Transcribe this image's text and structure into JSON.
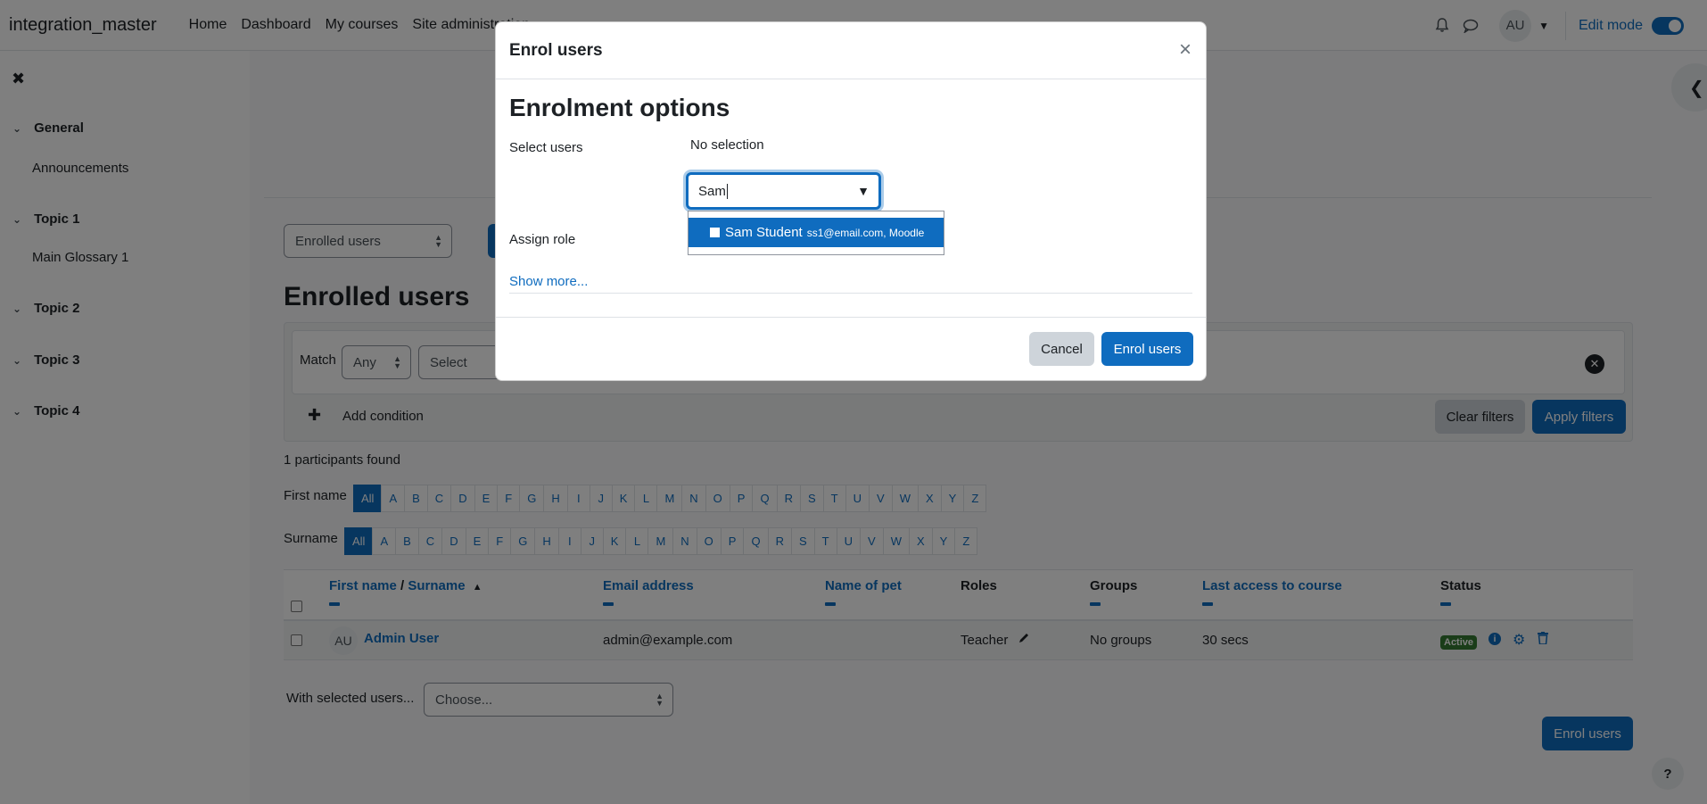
{
  "navbar": {
    "brand": "integration_master",
    "links": [
      "Home",
      "Dashboard",
      "My courses",
      "Site administration"
    ],
    "avatar_initials": "AU",
    "edit_mode_label": "Edit mode"
  },
  "drawer": {
    "sections": [
      {
        "title": "General",
        "activity": "Announcements"
      },
      {
        "title": "Topic 1",
        "activity": "Main Glossary 1"
      },
      {
        "title": "Topic 2",
        "activity": ""
      },
      {
        "title": "Topic 3",
        "activity": ""
      },
      {
        "title": "Topic 4",
        "activity": ""
      }
    ]
  },
  "main": {
    "view_select": "Enrolled users",
    "heading": "Enrolled users",
    "filter": {
      "match_label": "Match",
      "match_value": "Any",
      "type_select": "Select",
      "add_condition": "Add condition",
      "clear_filters": "Clear filters",
      "apply_filters": "Apply filters"
    },
    "participants_found": "1 participants found",
    "first_name_label": "First name",
    "surname_label": "Surname",
    "letters": [
      "All",
      "A",
      "B",
      "C",
      "D",
      "E",
      "F",
      "G",
      "H",
      "I",
      "J",
      "K",
      "L",
      "M",
      "N",
      "O",
      "P",
      "Q",
      "R",
      "S",
      "T",
      "U",
      "V",
      "W",
      "X",
      "Y",
      "Z"
    ],
    "table": {
      "headers": {
        "first_name": "First name",
        "slash": "/",
        "surname": "Surname",
        "email": "Email address",
        "pet": "Name of pet",
        "roles": "Roles",
        "groups": "Groups",
        "last_access": "Last access to course",
        "status": "Status"
      },
      "rows": [
        {
          "initials": "AU",
          "name": "Admin User",
          "email": "admin@example.com",
          "role": "Teacher",
          "groups": "No groups",
          "last_access": "30 secs",
          "status": "Active"
        }
      ]
    },
    "with_selected_label": "With selected users...",
    "with_selected_placeholder": "Choose...",
    "enrol_users_button": "Enrol users",
    "help": "?"
  },
  "modal": {
    "title": "Enrol users",
    "close": "×",
    "heading": "Enrolment options",
    "select_users_label": "Select users",
    "no_selection": "No selection",
    "search_value": "Sam",
    "assign_role_label": "Assign role",
    "suggestion": {
      "name": "Sam Student",
      "detail": "ss1@email.com, Moodle"
    },
    "show_more": "Show more...",
    "cancel": "Cancel",
    "enrol_users": "Enrol users"
  },
  "colors": {
    "primary": "#0f6cbf",
    "active_badge": "#357a32"
  }
}
